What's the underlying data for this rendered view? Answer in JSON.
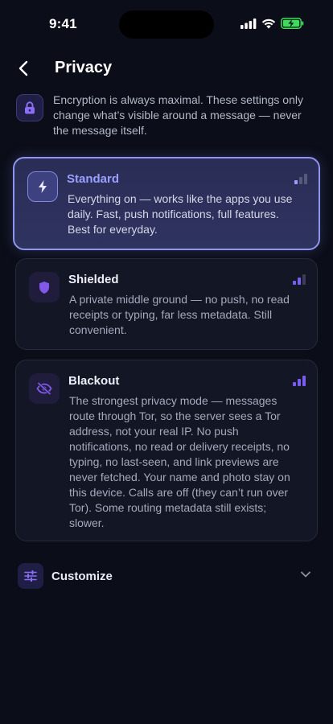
{
  "status_bar": {
    "time": "9:41"
  },
  "header": {
    "title": "Privacy"
  },
  "info": {
    "text": "Encryption is always maximal. These settings only change what’s visible around a message — never the message itself."
  },
  "modes": [
    {
      "title": "Standard",
      "description": "Everything on — works like the apps you use daily. Fast, push notifications, full features. Best for everyday.",
      "selected": true,
      "privacy_level": "1 of 3",
      "icon": "bolt-icon"
    },
    {
      "title": "Shielded",
      "description": "A private middle ground — no push, no read receipts or typing, far less metadata. Still convenient.",
      "selected": false,
      "privacy_level": "2 of 3",
      "icon": "shield-icon"
    },
    {
      "title": "Blackout",
      "description": "The strongest privacy mode — messages route through Tor, so the server sees a Tor address, not your real IP. No push notifications, no read or delivery receipts, no typing, no last-seen, and link previews are never fetched. Your name and photo stay on this device. Calls are off (they can’t run over Tor). Some routing metadata still exists; slower.",
      "selected": false,
      "privacy_level": "3 of 3",
      "icon": "eye-off-icon"
    }
  ],
  "customize": {
    "label": "Customize",
    "icon": "sliders-icon",
    "expanded": false
  },
  "colors": {
    "background": "#0b0e18",
    "accent": "#8f95ee",
    "accent_text": "#9aa0ff",
    "purple": "#7b5cf0",
    "battery": "#3ddc5a"
  }
}
